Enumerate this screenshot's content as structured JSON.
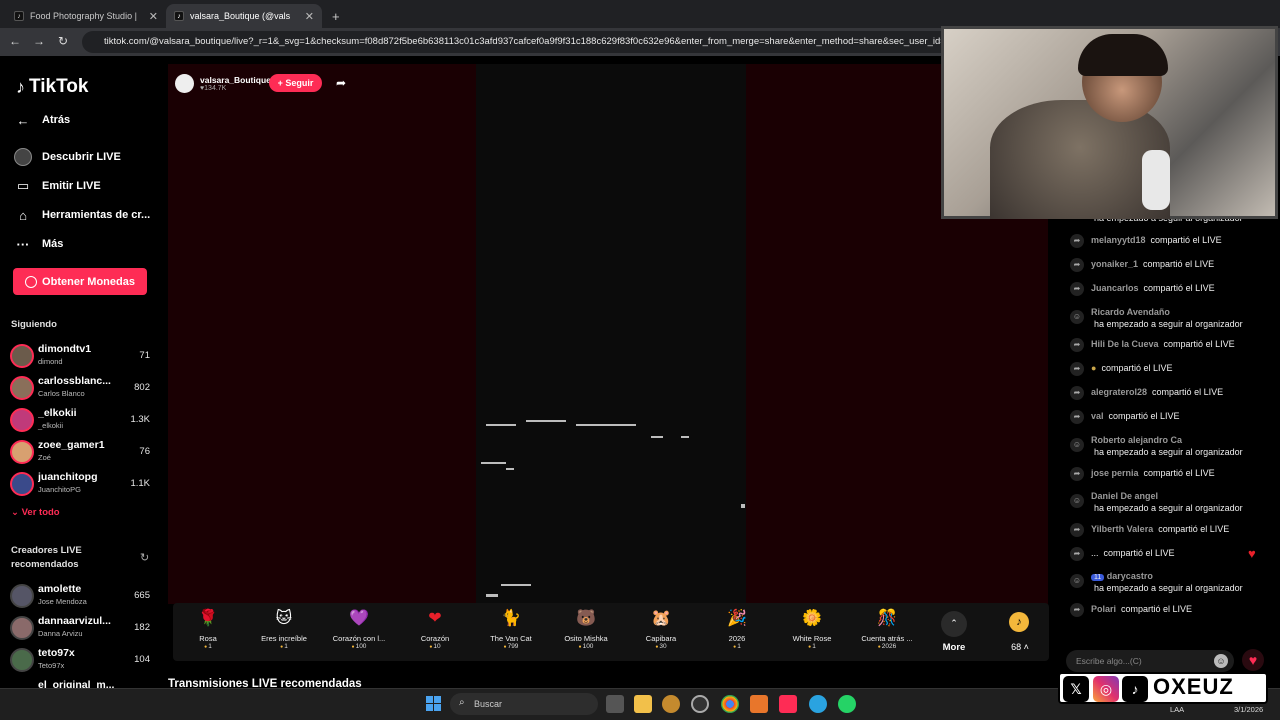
{
  "browser": {
    "tabs": [
      {
        "title": "Food Photography Studio |"
      },
      {
        "title": "valsara_Boutique (@valsara..."
      }
    ],
    "url": "tiktok.com/@valsara_boutique/live?_r=1&_svg=1&checksum=f08d872f5be6b638113c01c3afd937cafcef0a9f9f31c188c629f83f0c632e96&enter_from_merge=share&enter_method=share&sec_user_id=MS"
  },
  "sidebar": {
    "logo": "TikTok",
    "back": "Atrás",
    "nav": [
      "Descubrir LIVE",
      "Emitir LIVE",
      "Herramientas de cr...",
      "Más"
    ],
    "coins_button": "Obtener Monedas",
    "following_header": "Siguiendo",
    "following": [
      {
        "name": "dimondtv1",
        "sub": "dimond",
        "count": "71"
      },
      {
        "name": "carlossblanc...",
        "sub": "Carlos Blanco",
        "count": "802"
      },
      {
        "name": "_elkokii",
        "sub": "_elkokii",
        "count": "1.3K"
      },
      {
        "name": "zoee_gamer1",
        "sub": "Zoé",
        "count": "76"
      },
      {
        "name": "juanchitopg",
        "sub": "JuanchitoPG",
        "count": "1.1K"
      }
    ],
    "see_all": "Ver todo",
    "recommended_header": "Creadores LIVE recomendados",
    "recommended": [
      {
        "name": "amolette",
        "sub": "Jose Mendoza",
        "count": "665"
      },
      {
        "name": "dannaarvizul...",
        "sub": "Danna Arvizu",
        "count": "182"
      },
      {
        "name": "teto97x",
        "sub": "Teto97x",
        "count": "104"
      },
      {
        "name": "el_original_m...",
        "sub": "",
        "count": ""
      }
    ]
  },
  "host": {
    "name": "valsara_Boutique",
    "likes": "134.7K",
    "follow_button": "+ Seguir"
  },
  "gifts": [
    {
      "name": "Rosa",
      "price": "1",
      "icon": "🌹"
    },
    {
      "name": "Eres increíble",
      "price": "1",
      "icon": "🐱"
    },
    {
      "name": "Corazón con l...",
      "price": "100",
      "icon": "💜"
    },
    {
      "name": "Corazón",
      "price": "10",
      "icon": "❤"
    },
    {
      "name": "The Van Cat",
      "price": "799",
      "icon": "🐈"
    },
    {
      "name": "Osito Mishka",
      "price": "100",
      "icon": "🐻"
    },
    {
      "name": "Capibara",
      "price": "30",
      "icon": "🐹"
    },
    {
      "name": "2026",
      "price": "1",
      "icon": "🎉"
    },
    {
      "name": "White Rose",
      "price": "1",
      "icon": "🌼"
    },
    {
      "name": "Cuenta atrás ...",
      "price": "2026",
      "icon": "🎊"
    }
  ],
  "gift_more": "More",
  "coin_balance": "68",
  "recommended_section": "Transmisiones LIVE recomendadas",
  "chat": {
    "messages": [
      {
        "user": "",
        "text": "ha empezado a seguir al organizador",
        "two_line": false
      },
      {
        "user": "melanyytd18",
        "text": "compartió el LIVE"
      },
      {
        "user": "yonaiker_1",
        "text": "compartió el LIVE"
      },
      {
        "user": "Juancarlos",
        "text": "compartió el LIVE"
      },
      {
        "user": "Ricardo Avendaño",
        "text": "ha empezado a seguir al organizador",
        "two_line": true
      },
      {
        "user": "Hili De la Cueva",
        "text": "compartió el LIVE"
      },
      {
        "user": "",
        "text": "compartió el LIVE"
      },
      {
        "user": "alegraterol28",
        "text": "compartió el LIVE"
      },
      {
        "user": "val",
        "text": "compartió el LIVE"
      },
      {
        "user": "Roberto alejandro Ca",
        "text": "ha empezado a seguir al organizador",
        "two_line": true
      },
      {
        "user": "jose pernia",
        "text": "compartió el LIVE"
      },
      {
        "user": "Daniel De angel",
        "text": "ha empezado a seguir al organizador",
        "two_line": true
      },
      {
        "user": "Yilberth Valera",
        "text": "compartió el LIVE"
      },
      {
        "user": "...",
        "text": "compartió el LIVE"
      },
      {
        "user": "darycastro",
        "text": "ha empezado a seguir al organizador",
        "two_line": true,
        "badge": "11"
      },
      {
        "user": "Polari",
        "text": "compartió el LIVE"
      }
    ],
    "input_placeholder": "Escribe algo...(C)"
  },
  "overlay": {
    "brand": "OXEUZ"
  },
  "taskbar": {
    "search_placeholder": "Buscar",
    "lang": "LAA",
    "date": "3/1/2026"
  },
  "colors": {
    "accent": "#fe2c55",
    "coin": "#f3b73b"
  }
}
